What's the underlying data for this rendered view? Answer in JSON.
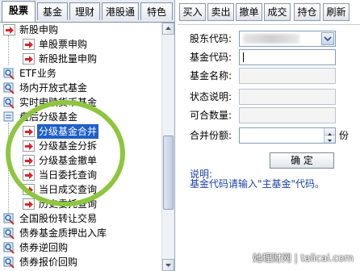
{
  "tabs": [
    "股票",
    "基金",
    "理财",
    "港股通",
    "特色"
  ],
  "tree": {
    "items": [
      {
        "label": "新股申购",
        "type": "category-arrow"
      },
      {
        "label": "单股票申购",
        "type": "child"
      },
      {
        "label": "新股批量申购",
        "type": "child"
      },
      {
        "label": "ETF业务",
        "type": "category"
      },
      {
        "label": "场内开放式基金",
        "type": "category"
      },
      {
        "label": "实时申赎货币基金",
        "type": "category"
      },
      {
        "label": "盘后分级基金",
        "type": "category-open"
      },
      {
        "label": "分级基金合并",
        "type": "child",
        "selected": true
      },
      {
        "label": "分级基金分拆",
        "type": "child"
      },
      {
        "label": "分级基金撤单",
        "type": "child"
      },
      {
        "label": "当日委托查询",
        "type": "child"
      },
      {
        "label": "当日成交查询",
        "type": "child"
      },
      {
        "label": "历史委托查询",
        "type": "child"
      },
      {
        "label": "全国股份转让交易",
        "type": "category"
      },
      {
        "label": "债券基金质押出入库",
        "type": "category"
      },
      {
        "label": "债券逆回购",
        "type": "category"
      },
      {
        "label": "债券报价回购",
        "type": "category"
      }
    ]
  },
  "toolbar": [
    "买入",
    "卖出",
    "撤单",
    "成交",
    "持仓",
    "刷新"
  ],
  "form": {
    "holder_code_label": "股东代码:",
    "fund_code_label": "基金代码:",
    "fund_name_label": "基金名称:",
    "status_label": "状态说明:",
    "mergeable_label": "可合数量:",
    "merge_amount_label": "合并份额:",
    "unit": "份",
    "confirm": "确 定"
  },
  "note": {
    "title": "说明:",
    "text": "基金代码请输入\"主基金\"代码。"
  },
  "watermark": "她理财网 | talicai.com",
  "colors": {
    "selection": "#1e5fc8",
    "highlight_ring": "#8ec63f",
    "arrow_red": "#d8262a",
    "note_blue": "#1b3fa3"
  }
}
